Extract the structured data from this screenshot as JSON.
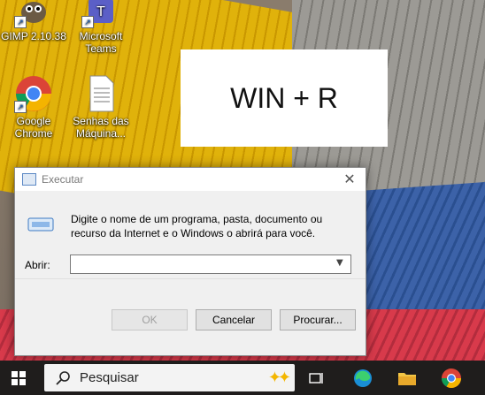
{
  "desktop": {
    "icons": [
      {
        "label": "GIMP 2.10.38",
        "icon": "gimp-icon"
      },
      {
        "label": "Microsoft Teams",
        "icon": "teams-icon"
      },
      {
        "label": "Google Chrome",
        "icon": "chrome-icon"
      },
      {
        "label": "Senhas das Máquina...",
        "icon": "text-file-icon"
      }
    ]
  },
  "hint": {
    "text": "WIN + R"
  },
  "run_dialog": {
    "title": "Executar",
    "description": "Digite o nome de um programa, pasta, documento ou recurso da Internet e o Windows o abrirá para você.",
    "open_label": "Abrir:",
    "open_value": "",
    "buttons": {
      "ok": "OK",
      "cancel": "Cancelar",
      "browse": "Procurar..."
    }
  },
  "taskbar": {
    "search_placeholder": "Pesquisar",
    "pinned": [
      "task-view-icon",
      "edge-icon",
      "file-explorer-icon",
      "chrome-icon"
    ]
  },
  "colors": {
    "accent": "#0078d4",
    "taskbar": "#1f1d1c"
  }
}
